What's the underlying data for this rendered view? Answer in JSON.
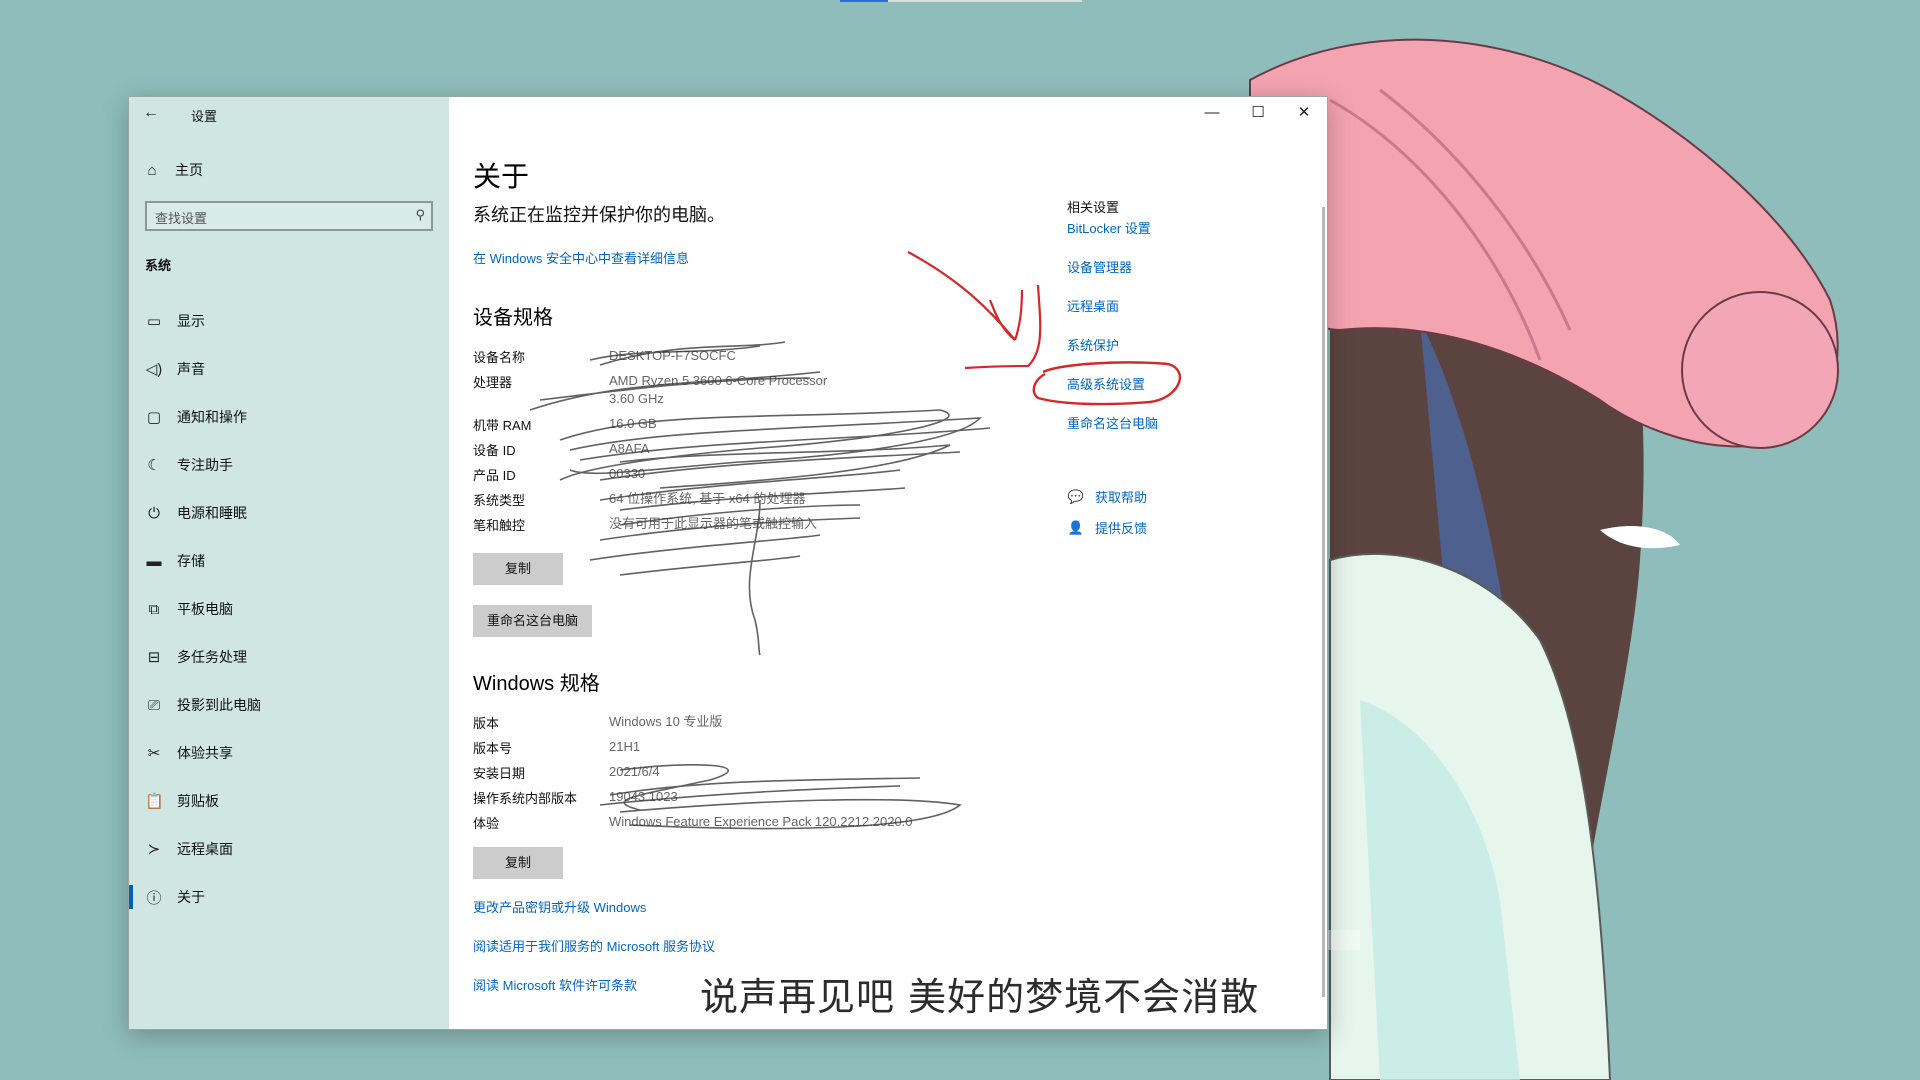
{
  "window": {
    "title": "设置",
    "back_icon": "←",
    "controls": {
      "minimize": "—",
      "maximize": "☐",
      "close": "✕"
    }
  },
  "sidebar": {
    "home_icon": "⌂",
    "home_label": "主页",
    "search_placeholder": "查找设置",
    "search_icon": "⚲",
    "section_label": "系统",
    "items": [
      {
        "icon": "▭",
        "label": "显示"
      },
      {
        "icon": "◁)",
        "label": "声音"
      },
      {
        "icon": "▢",
        "label": "通知和操作"
      },
      {
        "icon": "☾",
        "label": "专注助手"
      },
      {
        "icon": "⏻",
        "label": "电源和睡眠"
      },
      {
        "icon": "▬",
        "label": "存储"
      },
      {
        "icon": "⧉",
        "label": "平板电脑"
      },
      {
        "icon": "⊟",
        "label": "多任务处理"
      },
      {
        "icon": "⎚",
        "label": "投影到此电脑"
      },
      {
        "icon": "✂",
        "label": "体验共享"
      },
      {
        "icon": "📋",
        "label": "剪贴板"
      },
      {
        "icon": "≻",
        "label": "远程桌面"
      },
      {
        "icon": "ⓘ",
        "label": "关于"
      }
    ],
    "active_index": 12
  },
  "main": {
    "title": "关于",
    "status_text": "系统正在监控并保护你的电脑。",
    "security_link": "在 Windows 安全中心中查看详细信息",
    "device_spec_heading": "设备规格",
    "device_specs": [
      {
        "key": "设备名称",
        "value": "DESKTOP-F7SOCFC"
      },
      {
        "key": "处理器",
        "value": "AMD Ryzen 5 3600 6-Core Processor",
        "value2": "3.60 GHz"
      },
      {
        "key": "机带 RAM",
        "value": "16.0 GB"
      },
      {
        "key": "设备 ID",
        "value": "A8AFA"
      },
      {
        "key": "产品 ID",
        "value": "00330"
      },
      {
        "key": "系统类型",
        "value": "64 位操作系统, 基于 x64 的处理器"
      },
      {
        "key": "笔和触控",
        "value": "没有可用于此显示器的笔或触控输入"
      }
    ],
    "copy_label": "复制",
    "rename_label": "重命名这台电脑",
    "windows_spec_heading": "Windows 规格",
    "windows_specs": [
      {
        "key": "版本",
        "value": "Windows 10 专业版"
      },
      {
        "key": "版本号",
        "value": "21H1"
      },
      {
        "key": "安装日期",
        "value": "2021/6/4"
      },
      {
        "key": "操作系统内部版本",
        "value": "19043.1023"
      },
      {
        "key": "体验",
        "value": "Windows Feature Experience Pack 120.2212.2020.0"
      }
    ],
    "copy2_label": "复制",
    "links": [
      "更改产品密钥或升级 Windows",
      "阅读适用于我们服务的 Microsoft 服务协议",
      "阅读 Microsoft 软件许可条款"
    ]
  },
  "related": {
    "title": "相关设置",
    "links": [
      "BitLocker 设置",
      "设备管理器",
      "远程桌面",
      "系统保护",
      "高级系统设置",
      "重命名这台电脑"
    ],
    "help_icon": "💬",
    "help_label": "获取帮助",
    "feedback_icon": "👤",
    "feedback_label": "提供反馈"
  },
  "overlay": {
    "subtitle": "说声再见吧 美好的梦境不会消散",
    "annotation_color": "#d62828"
  }
}
